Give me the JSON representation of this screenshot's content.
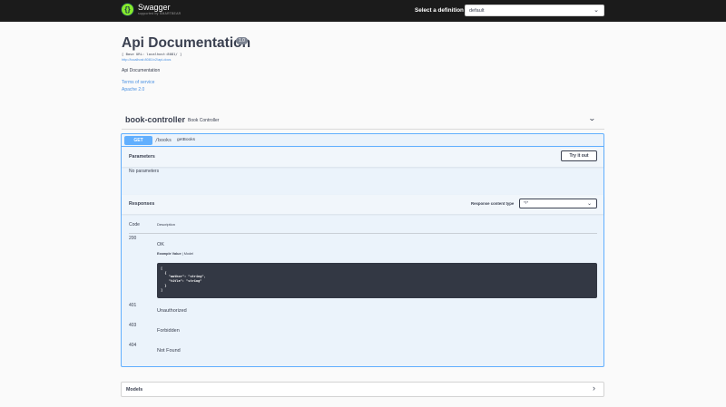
{
  "topbar": {
    "logo_title": "Swagger",
    "logo_sub": "supported by SMARTBEAR",
    "definition_label": "Select a definition",
    "definition_value": "default"
  },
  "info": {
    "title": "Api Documentation",
    "version": "1.0",
    "base_url": "[ Base URL: localhost:8081/ ]",
    "docs_link": "http://localhost:8081/v2/api-docs",
    "description": "Api Documentation",
    "terms": "Terms of service",
    "license": "Apache 2.0"
  },
  "tag": {
    "name": "book-controller",
    "description": "Book Controller"
  },
  "operation": {
    "method": "GET",
    "path": "/books",
    "summary": "getBooks",
    "parameters_title": "Parameters",
    "try_button": "Try it out",
    "no_params": "No parameters",
    "responses_title": "Responses",
    "content_type_label": "Response content type",
    "content_type_value": "*/*",
    "col_code": "Code",
    "col_description": "Description",
    "responses": [
      {
        "code": "200",
        "description": "OK"
      },
      {
        "code": "401",
        "description": "Unauthorized"
      },
      {
        "code": "403",
        "description": "Forbidden"
      },
      {
        "code": "404",
        "description": "Not Found"
      }
    ],
    "example_tab": "Example Value",
    "model_tab": "Model",
    "example_json": "[\n  {\n    \"author\": \"string\",\n    \"title\": \"string\"\n  }\n]"
  },
  "models": {
    "title": "Models"
  }
}
